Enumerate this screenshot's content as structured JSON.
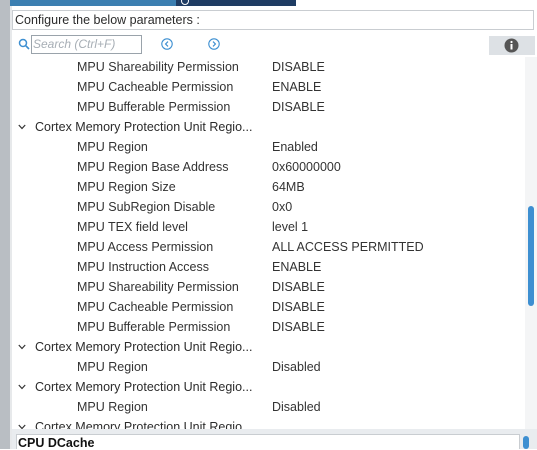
{
  "header": {
    "title": "Configure the below parameters :"
  },
  "search": {
    "placeholder": "Search (Ctrl+F)"
  },
  "icons": {
    "search": "search-icon",
    "prev": "circle-chevron-left-icon",
    "next": "circle-chevron-right-icon",
    "info": "info-icon",
    "expand": "chevron-down-icon"
  },
  "colors": {
    "accent": "#3d8fd1",
    "tab_active": "#3c7fb1",
    "tab_dark": "#1f3c63"
  },
  "rows": [
    {
      "name": "MPU Shareability Permission",
      "value": "DISABLE"
    },
    {
      "name": "MPU Cacheable Permission",
      "value": "ENABLE"
    },
    {
      "name": "MPU Bufferable  Permission",
      "value": "DISABLE"
    },
    {
      "group": true,
      "name": "Cortex Memory Protection Unit Regio..."
    },
    {
      "name": "MPU Region",
      "value": "Enabled"
    },
    {
      "name": "MPU Region Base Address",
      "value": "0x60000000"
    },
    {
      "name": "MPU Region Size",
      "value": "64MB"
    },
    {
      "name": "MPU SubRegion Disable",
      "value": "0x0"
    },
    {
      "name": "MPU TEX field level",
      "value": "level 1"
    },
    {
      "name": "MPU Access Permission",
      "value": "ALL ACCESS PERMITTED"
    },
    {
      "name": "MPU Instruction Access",
      "value": "ENABLE"
    },
    {
      "name": "MPU Shareability Permission",
      "value": "DISABLE"
    },
    {
      "name": "MPU Cacheable Permission",
      "value": "DISABLE"
    },
    {
      "name": "MPU Bufferable  Permission",
      "value": "DISABLE"
    },
    {
      "group": true,
      "name": "Cortex Memory Protection Unit Regio..."
    },
    {
      "name": "MPU Region",
      "value": "Disabled"
    },
    {
      "group": true,
      "name": "Cortex Memory Protection Unit Regio..."
    },
    {
      "name": "MPU Region",
      "value": "Disabled"
    },
    {
      "group": true,
      "name": "Cortex Memory Protection Unit Regio..."
    }
  ],
  "footer": {
    "label": "CPU DCache"
  }
}
